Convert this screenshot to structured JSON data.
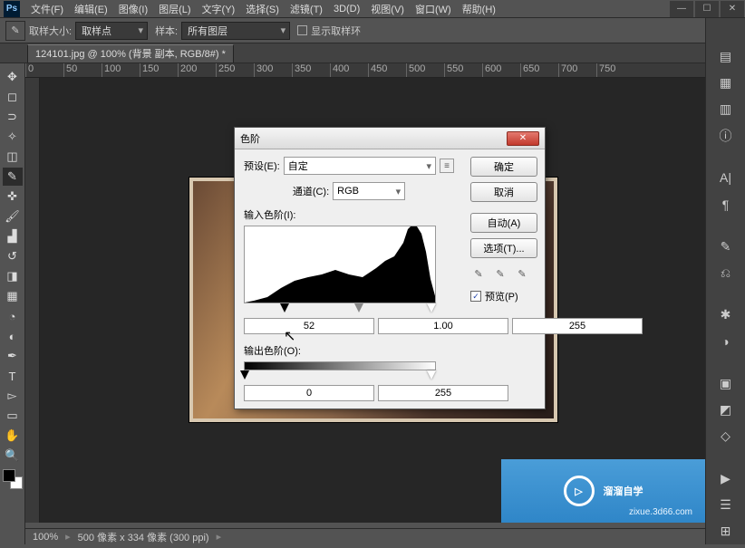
{
  "app": {
    "logo": "Ps"
  },
  "menu": {
    "file": "文件(F)",
    "edit": "编辑(E)",
    "image": "图像(I)",
    "layer": "图层(L)",
    "type": "文字(Y)",
    "select": "选择(S)",
    "filter": "滤镜(T)",
    "threeD": "3D(D)",
    "view": "视图(V)",
    "window": "窗口(W)",
    "help": "帮助(H)"
  },
  "opt": {
    "sampleSizeLabel": "取样大小:",
    "sampleSize": "取样点",
    "sampleLabel": "样本:",
    "sample": "所有图层",
    "showRingLabel": "显示取样环"
  },
  "tab": {
    "name": "124101.jpg @ 100% (背景 副本, RGB/8#) *"
  },
  "ruler": [
    "0",
    "50",
    "100",
    "150",
    "200",
    "250",
    "300",
    "350",
    "400",
    "450",
    "500",
    "550",
    "600",
    "650",
    "700",
    "750"
  ],
  "status": {
    "zoom": "100%",
    "size": "500 像素 x 334 像素 (300 ppi)"
  },
  "dialog": {
    "title": "色阶",
    "presetLabel": "预设(E):",
    "preset": "自定",
    "channelLabel": "通道(C):",
    "channel": "RGB",
    "inputLabel": "输入色阶(I):",
    "inBlack": "52",
    "inGamma": "1.00",
    "inWhite": "255",
    "outputLabel": "输出色阶(O):",
    "outBlack": "0",
    "outWhite": "255",
    "ok": "确定",
    "cancel": "取消",
    "auto": "自动(A)",
    "options": "选项(T)...",
    "previewLabel": "预览(P)"
  },
  "watermark": {
    "brand": "溜溜自学",
    "url": "zixue.3d66.com"
  }
}
